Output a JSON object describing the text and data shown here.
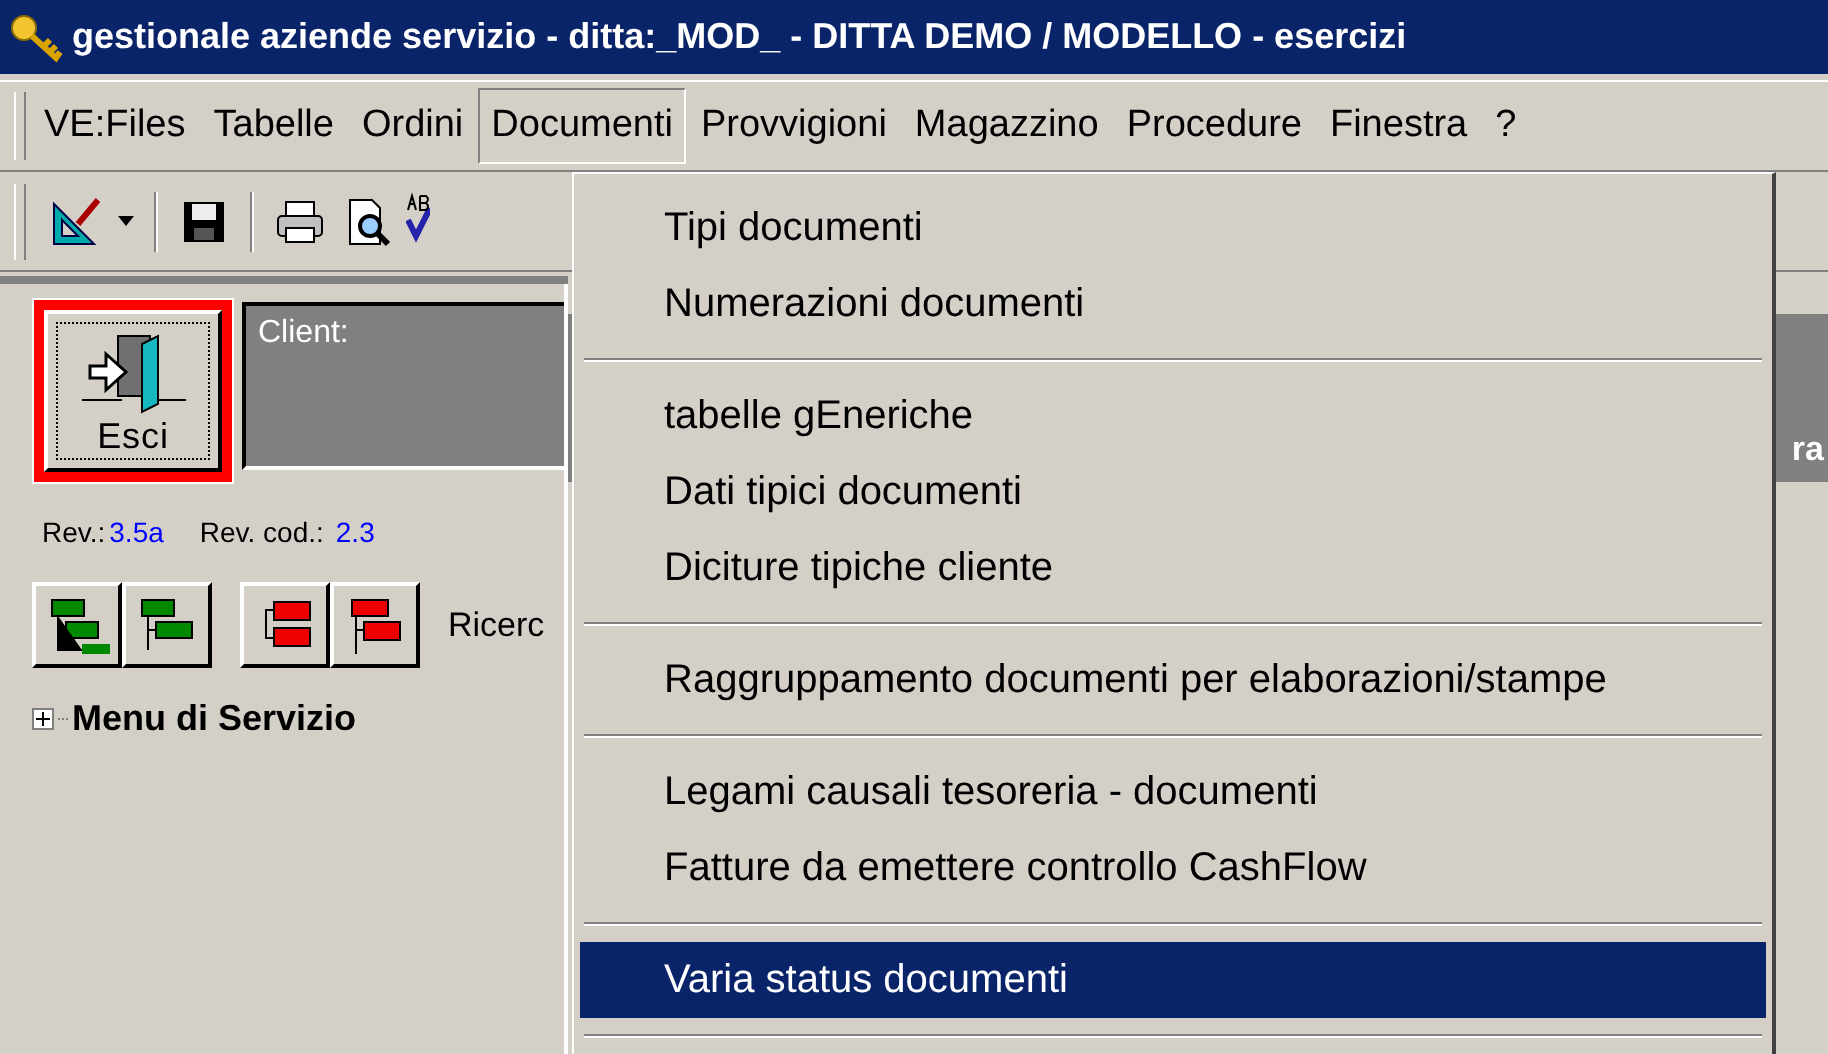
{
  "window": {
    "title": "gestionale aziende servizio - ditta:_MOD_ - DITTA DEMO / MODELLO - esercizi"
  },
  "menu_bar": [
    {
      "label": "VE:Files",
      "selected": false
    },
    {
      "label": "Tabelle",
      "selected": false
    },
    {
      "label": "Ordini",
      "selected": false
    },
    {
      "label": "Documenti",
      "selected": true
    },
    {
      "label": "Provvigioni",
      "selected": false
    },
    {
      "label": "Magazzino",
      "selected": false
    },
    {
      "label": "Procedure",
      "selected": false
    },
    {
      "label": "Finestra",
      "selected": false
    },
    {
      "label": "?",
      "selected": false
    }
  ],
  "dropdown": [
    {
      "kind": "item",
      "label": "Tipi documenti",
      "selected": false
    },
    {
      "kind": "item",
      "label": "Numerazioni documenti",
      "selected": false
    },
    {
      "kind": "separator"
    },
    {
      "kind": "item",
      "label": "tabelle gEneriche",
      "selected": false
    },
    {
      "kind": "item",
      "label": "Dati tipici documenti",
      "selected": false
    },
    {
      "kind": "item",
      "label": "Diciture tipiche cliente",
      "selected": false
    },
    {
      "kind": "separator"
    },
    {
      "kind": "item",
      "label": "Raggruppamento documenti per elaborazioni/stampe",
      "selected": false
    },
    {
      "kind": "separator"
    },
    {
      "kind": "item",
      "label": "Legami causali tesoreria - documenti",
      "selected": false
    },
    {
      "kind": "item",
      "label": "Fatture da emettere controllo CashFlow",
      "selected": false
    },
    {
      "kind": "separator"
    },
    {
      "kind": "item",
      "label": "Varia status documenti",
      "selected": true
    },
    {
      "kind": "separator"
    }
  ],
  "exit_button": {
    "label": "Esci"
  },
  "client_panel": {
    "label": "Client:",
    "column_2": "ra"
  },
  "revision": {
    "label": "Rev.:",
    "value": "3.5a"
  },
  "code_revision": {
    "label": "Rev. cod.:",
    "value": "2.3"
  },
  "search_label": "Ricerc",
  "tree": [
    {
      "label": "Menu di Servizio",
      "expanded": false
    }
  ]
}
